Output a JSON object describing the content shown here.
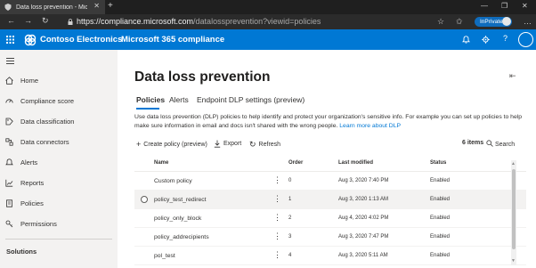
{
  "browser": {
    "tab_title": "Data loss prevention - Microsoft",
    "tab_close": "✕",
    "new_tab": "+",
    "url_main": "https://compliance.microsoft.com",
    "url_path": "/datalossprevention?viewid=policies",
    "inprivate_label": "InPrivate",
    "nav_back": "←",
    "nav_forward": "→",
    "nav_refresh": "↻",
    "window_min": "—",
    "window_max": "❐",
    "window_close": "✕",
    "favorite_icon": "☆",
    "collections_icon": "✩",
    "menu_icon": "…"
  },
  "app_header": {
    "brand": "Contoso Electronics",
    "product": "Microsoft 365 compliance",
    "help": "?",
    "bell": "🔔",
    "gear": "⚙"
  },
  "sidebar": {
    "items": [
      {
        "label": "Home"
      },
      {
        "label": "Compliance score"
      },
      {
        "label": "Data classification"
      },
      {
        "label": "Data connectors"
      },
      {
        "label": "Alerts"
      },
      {
        "label": "Reports"
      },
      {
        "label": "Policies"
      },
      {
        "label": "Permissions"
      }
    ],
    "section_label": "Solutions"
  },
  "main": {
    "title": "Data loss prevention",
    "tabs": [
      {
        "label": "Policies"
      },
      {
        "label": "Alerts"
      },
      {
        "label": "Endpoint DLP settings (preview)"
      }
    ],
    "description": "Use data loss prevention (DLP) policies to help identify and protect your organization's sensitive info. For example you can set up policies to help make sure information in email and docs isn't shared with the wrong people.",
    "learn_more": "Learn more about DLP",
    "commands": {
      "create": "Create policy (preview)",
      "export": "Export",
      "refresh": "Refresh",
      "item_count": "6 items",
      "search": "Search"
    },
    "table": {
      "columns": [
        "Name",
        "Order",
        "Last modified",
        "Status"
      ],
      "rows": [
        {
          "name": "Custom policy",
          "order": "0",
          "modified": "Aug 3, 2020 7:40 PM",
          "status": "Enabled"
        },
        {
          "name": "policy_test_redirect",
          "order": "1",
          "modified": "Aug 3, 2020 1:13 AM",
          "status": "Enabled"
        },
        {
          "name": "policy_only_block",
          "order": "2",
          "modified": "Aug 4, 2020 4:02 PM",
          "status": "Enabled"
        },
        {
          "name": "policy_addrecipients",
          "order": "3",
          "modified": "Aug 3, 2020 7:47 PM",
          "status": "Enabled"
        },
        {
          "name": "pol_test",
          "order": "4",
          "modified": "Aug 3, 2020 5:11 AM",
          "status": "Enabled"
        }
      ]
    }
  },
  "colors": {
    "accent": "#0078d4",
    "nav_bg": "#f3f2f1",
    "browser_chrome": "#2b2b2b"
  }
}
